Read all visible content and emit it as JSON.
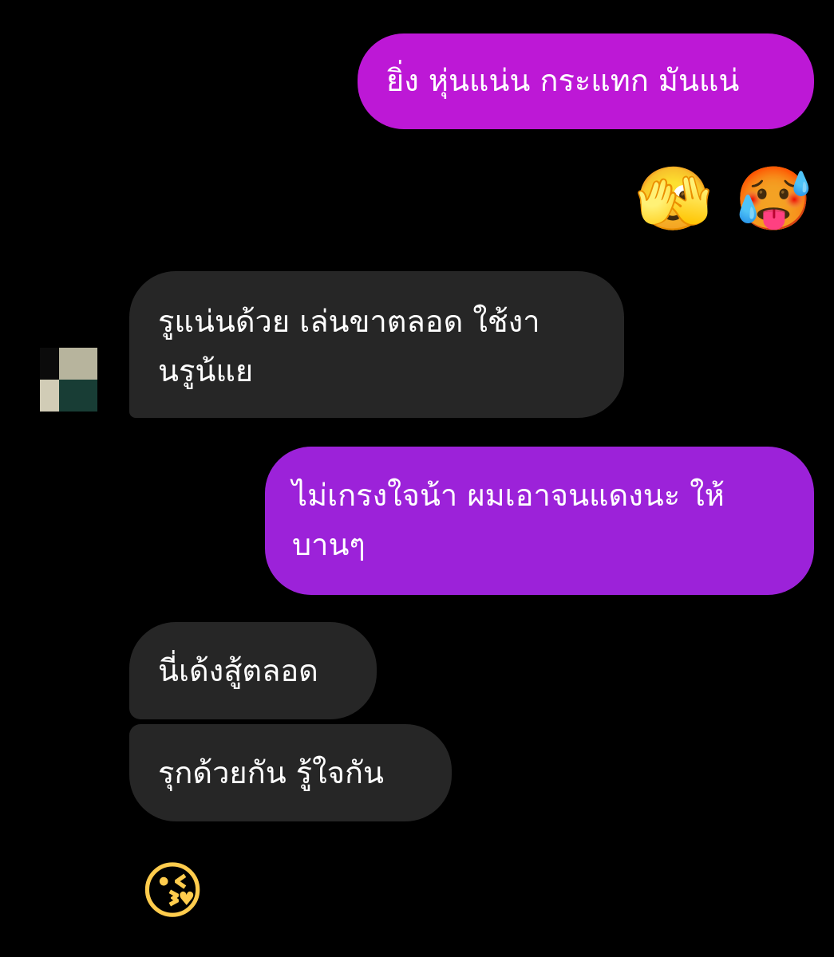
{
  "messages": {
    "m1": {
      "text": "ยิ่ง หุ่นแน่น กระแทก มันแน่"
    },
    "m1_reactions": {
      "emoji_1": "🫣",
      "emoji_2": "🥵"
    },
    "m2": {
      "text": "รูแน่นด้วย เล่นขาตลอด ใช้งานรูน้แย"
    },
    "m3": {
      "text": "ไม่เกรงใจน้า ผมเอาจนแดงนะ ให้บานๆ"
    },
    "m4": {
      "text": "นี่เด้งสู้ตลอด"
    },
    "m5": {
      "text": "รุกด้วยกัน รู้ใจกัน"
    },
    "m6": {
      "emoji": "😘"
    }
  },
  "colors": {
    "background": "#000000",
    "outgoing_pink": "#bd18d6",
    "outgoing_purple": "#9c22d9",
    "incoming": "#262626",
    "text": "#ffffff"
  }
}
